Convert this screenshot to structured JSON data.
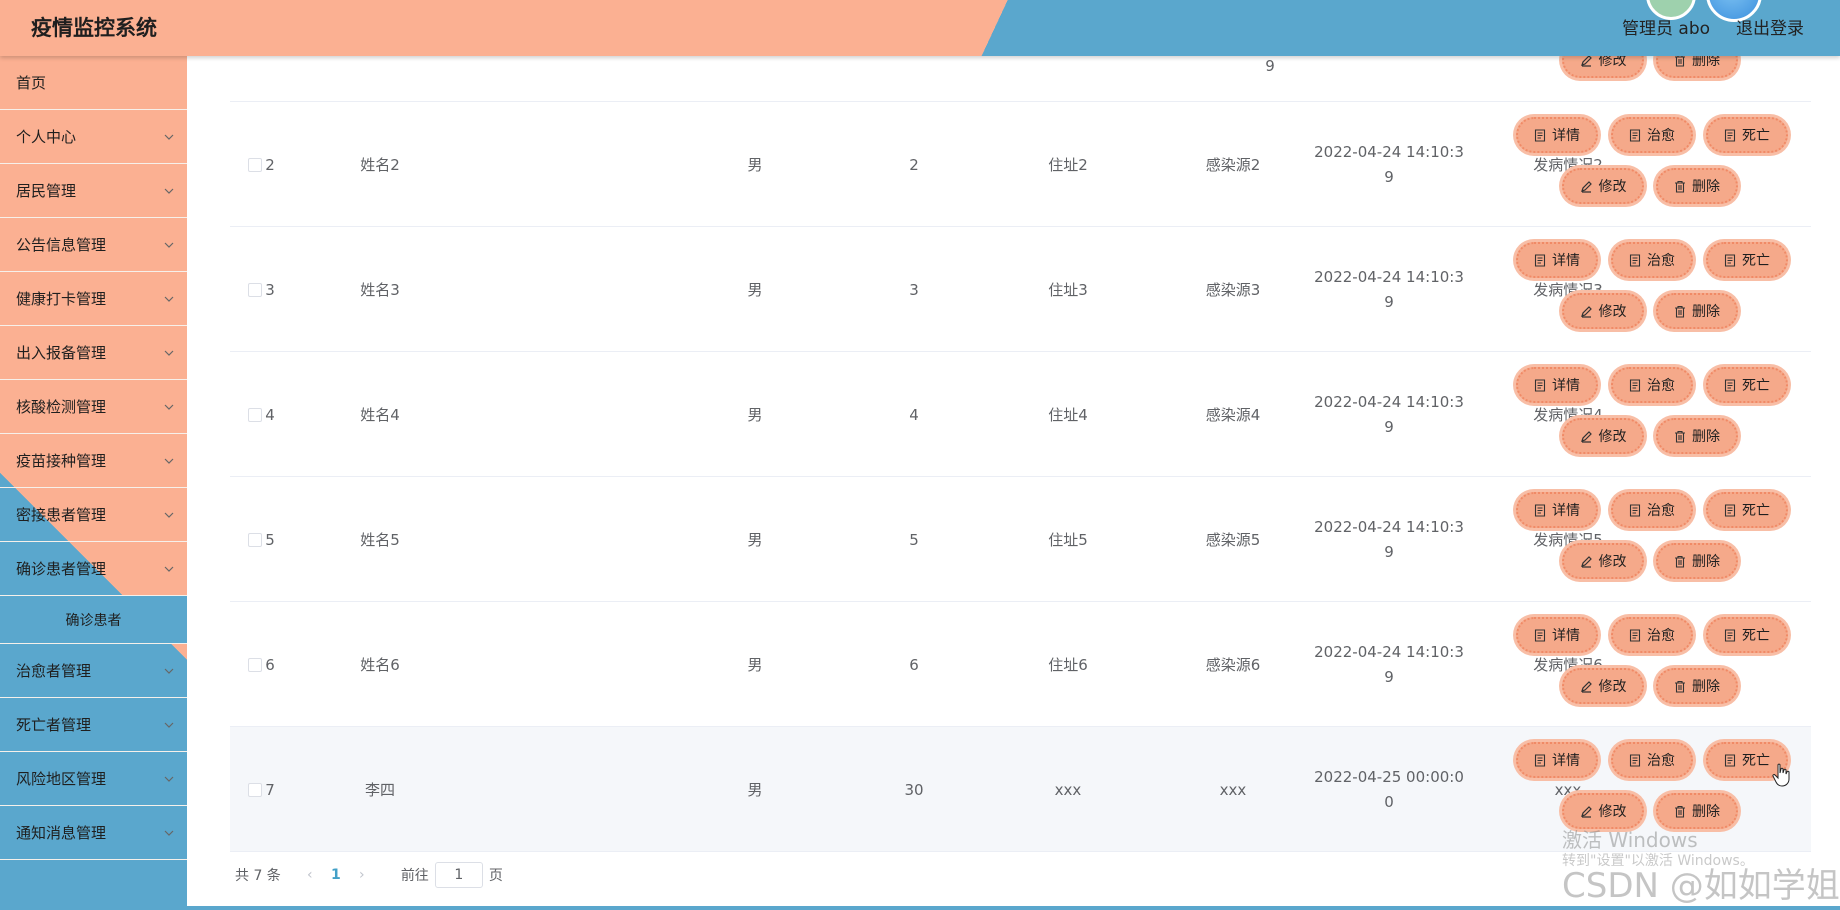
{
  "header": {
    "title": "疫情监控系统",
    "admin_label": "管理员 abo",
    "logout_label": "退出登录"
  },
  "sidebar": {
    "items": [
      {
        "label": "首页",
        "chevron": false
      },
      {
        "label": "个人中心",
        "chevron": true
      },
      {
        "label": "居民管理",
        "chevron": true
      },
      {
        "label": "公告信息管理",
        "chevron": true
      },
      {
        "label": "健康打卡管理",
        "chevron": true
      },
      {
        "label": "出入报备管理",
        "chevron": true
      },
      {
        "label": "核酸检测管理",
        "chevron": true
      },
      {
        "label": "疫苗接种管理",
        "chevron": true
      },
      {
        "label": "密接患者管理",
        "chevron": true
      },
      {
        "label": "确诊患者管理",
        "chevron": true
      }
    ],
    "submenu_active": "确诊患者",
    "items_after": [
      {
        "label": "治愈者管理",
        "chevron": true
      },
      {
        "label": "死亡者管理",
        "chevron": true
      },
      {
        "label": "风险地区管理",
        "chevron": true
      },
      {
        "label": "通知消息管理",
        "chevron": true
      }
    ]
  },
  "partial_row": {
    "time_tail": "9"
  },
  "buttons": {
    "detail": "详情",
    "cure": "治愈",
    "death": "死亡",
    "edit": "修改",
    "delete": "删除"
  },
  "rows": [
    {
      "index": "2",
      "name": "姓名2",
      "gender": "男",
      "age": "2",
      "address": "住址2",
      "source": "感染源2",
      "time": "2022-04-24 14:10:39",
      "condition": "发病情况2"
    },
    {
      "index": "3",
      "name": "姓名3",
      "gender": "男",
      "age": "3",
      "address": "住址3",
      "source": "感染源3",
      "time": "2022-04-24 14:10:39",
      "condition": "发病情况3"
    },
    {
      "index": "4",
      "name": "姓名4",
      "gender": "男",
      "age": "4",
      "address": "住址4",
      "source": "感染源4",
      "time": "2022-04-24 14:10:39",
      "condition": "发病情况4"
    },
    {
      "index": "5",
      "name": "姓名5",
      "gender": "男",
      "age": "5",
      "address": "住址5",
      "source": "感染源5",
      "time": "2022-04-24 14:10:39",
      "condition": "发病情况5"
    },
    {
      "index": "6",
      "name": "姓名6",
      "gender": "男",
      "age": "6",
      "address": "住址6",
      "source": "感染源6",
      "time": "2022-04-24 14:10:39",
      "condition": "发病情况6"
    },
    {
      "index": "7",
      "name": "李四",
      "gender": "男",
      "age": "30",
      "address": "xxx",
      "source": "xxx",
      "time": "2022-04-25 00:00:00",
      "condition": "xxx"
    }
  ],
  "pagination": {
    "total_label": "共 7 条",
    "current_page": "1",
    "goto_label": "前往",
    "goto_value": "1",
    "page_suffix": "页"
  },
  "watermark": {
    "activate_title": "激活 Windows",
    "activate_sub": "转到\"设置\"以激活 Windows。",
    "csdn": "CSDN @如如学姐"
  },
  "colors": {
    "accent_orange": "#fbb092",
    "accent_blue": "#5aa7cd",
    "button_bg": "#f5a98a",
    "page_active": "#43a0c7"
  }
}
